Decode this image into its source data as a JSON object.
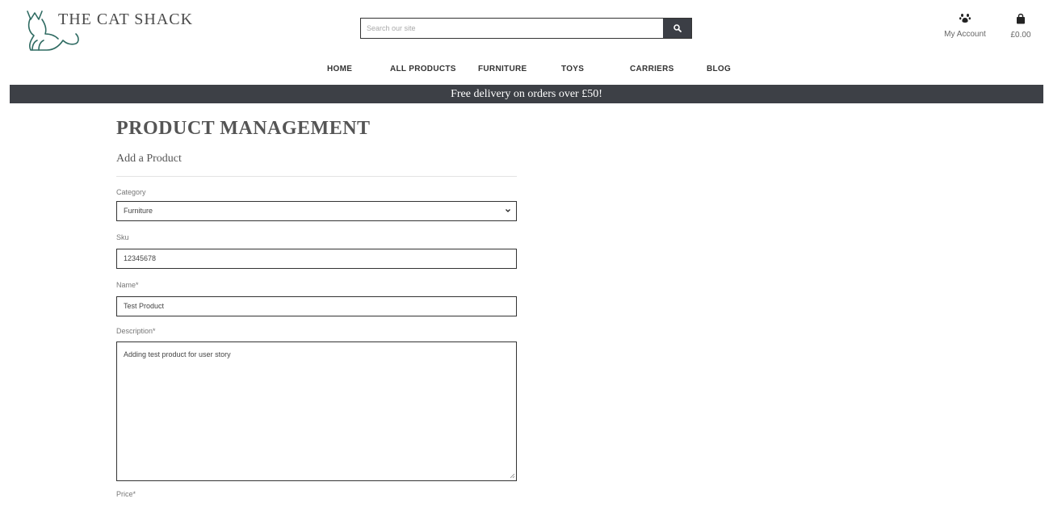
{
  "brand": {
    "name": "THE CAT SHACK"
  },
  "search": {
    "placeholder": "Search our site"
  },
  "header": {
    "account_label": "My Account",
    "bag_total": "£0.00"
  },
  "nav": {
    "items": [
      "HOME",
      "ALL PRODUCTS",
      "FURNITURE",
      "TOYS",
      "CARRIERS",
      "BLOG"
    ]
  },
  "banner": {
    "text": "Free delivery on orders over £50!"
  },
  "page": {
    "title": "PRODUCT MANAGEMENT",
    "subtitle": "Add a Product"
  },
  "form": {
    "category": {
      "label": "Category",
      "value": "Furniture"
    },
    "sku": {
      "label": "Sku",
      "value": "12345678"
    },
    "name": {
      "label": "Name*",
      "value": "Test Product"
    },
    "description": {
      "label": "Description*",
      "value": "Adding test product for user story"
    },
    "price": {
      "label": "Price*"
    }
  },
  "colors": {
    "banner_bg": "#3d4046",
    "logo_stroke": "#2f6b62",
    "border": "#333333"
  },
  "icons": {
    "search": "search-icon",
    "account": "paw-icon",
    "bag": "shopping-bag-icon",
    "logo": "cat-logo-icon"
  }
}
